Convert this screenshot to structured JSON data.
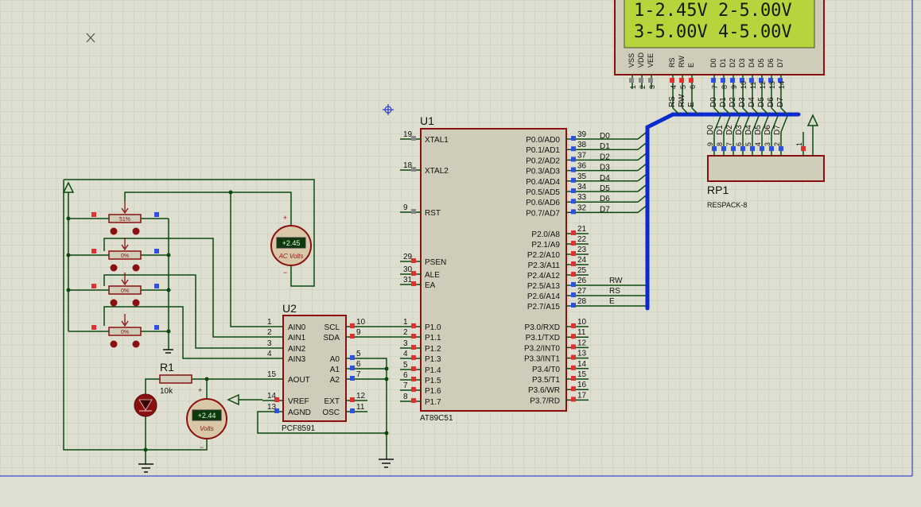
{
  "lcd": {
    "line1": "1-2.45V 2-5.00V",
    "line2": "3-5.00V 4-5.00V",
    "pin_labels": [
      "VSS",
      "VDD",
      "VEE",
      "RS",
      "RW",
      "E",
      "D0",
      "D1",
      "D2",
      "D3",
      "D4",
      "D5",
      "D6",
      "D7"
    ],
    "pin_numbers": [
      "1",
      "2",
      "3",
      "4",
      "5",
      "6",
      "7",
      "8",
      "9",
      "10",
      "11",
      "12",
      "13",
      "14"
    ],
    "bus_labels": [
      "RS",
      "RW",
      "E",
      "D0",
      "D1",
      "D2",
      "D3",
      "D4",
      "D5",
      "D6",
      "D7"
    ]
  },
  "u1": {
    "ref": "U1",
    "part": "AT89C51",
    "left_pins": [
      {
        "num": "19",
        "name": "XTAL1"
      },
      {
        "num": "18",
        "name": "XTAL2"
      },
      {
        "num": "9",
        "name": "RST"
      },
      {
        "num": "29",
        "name": "PSEN"
      },
      {
        "num": "30",
        "name": "ALE"
      },
      {
        "num": "31",
        "name": "EA"
      },
      {
        "num": "1",
        "name": "P1.0"
      },
      {
        "num": "2",
        "name": "P1.1"
      },
      {
        "num": "3",
        "name": "P1.2"
      },
      {
        "num": "4",
        "name": "P1.3"
      },
      {
        "num": "5",
        "name": "P1.4"
      },
      {
        "num": "6",
        "name": "P1.5"
      },
      {
        "num": "7",
        "name": "P1.6"
      },
      {
        "num": "8",
        "name": "P1.7"
      }
    ],
    "right_pins": [
      {
        "num": "39",
        "name": "P0.0/AD0"
      },
      {
        "num": "38",
        "name": "P0.1/AD1"
      },
      {
        "num": "37",
        "name": "P0.2/AD2"
      },
      {
        "num": "36",
        "name": "P0.3/AD3"
      },
      {
        "num": "35",
        "name": "P0.4/AD4"
      },
      {
        "num": "34",
        "name": "P0.5/AD5"
      },
      {
        "num": "33",
        "name": "P0.6/AD6"
      },
      {
        "num": "32",
        "name": "P0.7/AD7"
      },
      {
        "num": "21",
        "name": "P2.0/A8"
      },
      {
        "num": "22",
        "name": "P2.1/A9"
      },
      {
        "num": "23",
        "name": "P2.2/A10"
      },
      {
        "num": "24",
        "name": "P2.3/A11"
      },
      {
        "num": "25",
        "name": "P2.4/A12"
      },
      {
        "num": "26",
        "name": "P2.5/A13"
      },
      {
        "num": "27",
        "name": "P2.6/A14"
      },
      {
        "num": "28",
        "name": "P2.7/A15"
      },
      {
        "num": "10",
        "name": "P3.0/RXD"
      },
      {
        "num": "11",
        "name": "P3.1/TXD"
      },
      {
        "num": "12",
        "name": "P3.2/INT0"
      },
      {
        "num": "13",
        "name": "P3.3/INT1"
      },
      {
        "num": "14",
        "name": "P3.4/T0"
      },
      {
        "num": "15",
        "name": "P3.5/T1"
      },
      {
        "num": "16",
        "name": "P3.6/WR"
      },
      {
        "num": "17",
        "name": "P3.7/RD"
      }
    ],
    "port0_nets": [
      "D0",
      "D1",
      "D2",
      "D3",
      "D4",
      "D5",
      "D6",
      "D7"
    ],
    "port2_nets": [
      "RW",
      "RS",
      "E"
    ]
  },
  "u2": {
    "ref": "U2",
    "part": "PCF8591",
    "left_pins": [
      {
        "num": "1",
        "name": "AIN0"
      },
      {
        "num": "2",
        "name": "AIN1"
      },
      {
        "num": "3",
        "name": "AIN2"
      },
      {
        "num": "4",
        "name": "AIN3"
      },
      {
        "num": "15",
        "name": "AOUT"
      },
      {
        "num": "14",
        "name": "VREF"
      },
      {
        "num": "13",
        "name": "AGND"
      }
    ],
    "right_pins": [
      {
        "num": "10",
        "name": "SCL"
      },
      {
        "num": "9",
        "name": "SDA"
      },
      {
        "num": "5",
        "name": "A0"
      },
      {
        "num": "6",
        "name": "A1"
      },
      {
        "num": "7",
        "name": "A2"
      },
      {
        "num": "12",
        "name": "EXT"
      },
      {
        "num": "11",
        "name": "OSC"
      }
    ]
  },
  "rp1": {
    "ref": "RP1",
    "part": "RESPACK-8",
    "pin_labels": [
      "D0",
      "D1",
      "D2",
      "D3",
      "D4",
      "D5",
      "D6",
      "D7"
    ],
    "pin_numbers": [
      "9",
      "8",
      "7",
      "6",
      "5",
      "4",
      "3",
      "2",
      "1"
    ]
  },
  "r1": {
    "ref": "R1",
    "value": "10k"
  },
  "pots": [
    {
      "value": "51%"
    },
    {
      "value": "0%"
    },
    {
      "value": "0%"
    },
    {
      "value": "0%"
    }
  ],
  "meters": [
    {
      "reading": "+2.45",
      "unit": "AC Volts"
    },
    {
      "reading": "+2.44",
      "unit": "Volts"
    }
  ],
  "colors": {
    "background": "#dedfd0",
    "grid": "#c6c8b6",
    "wire": "#0a4a10",
    "bus": "#0a2ad0",
    "component": "#8a1010",
    "chip_fill": "#cfcdb9",
    "lcd_screen": "#b8d43c",
    "pin_red": "#e03030",
    "pin_blue": "#3050e0"
  }
}
